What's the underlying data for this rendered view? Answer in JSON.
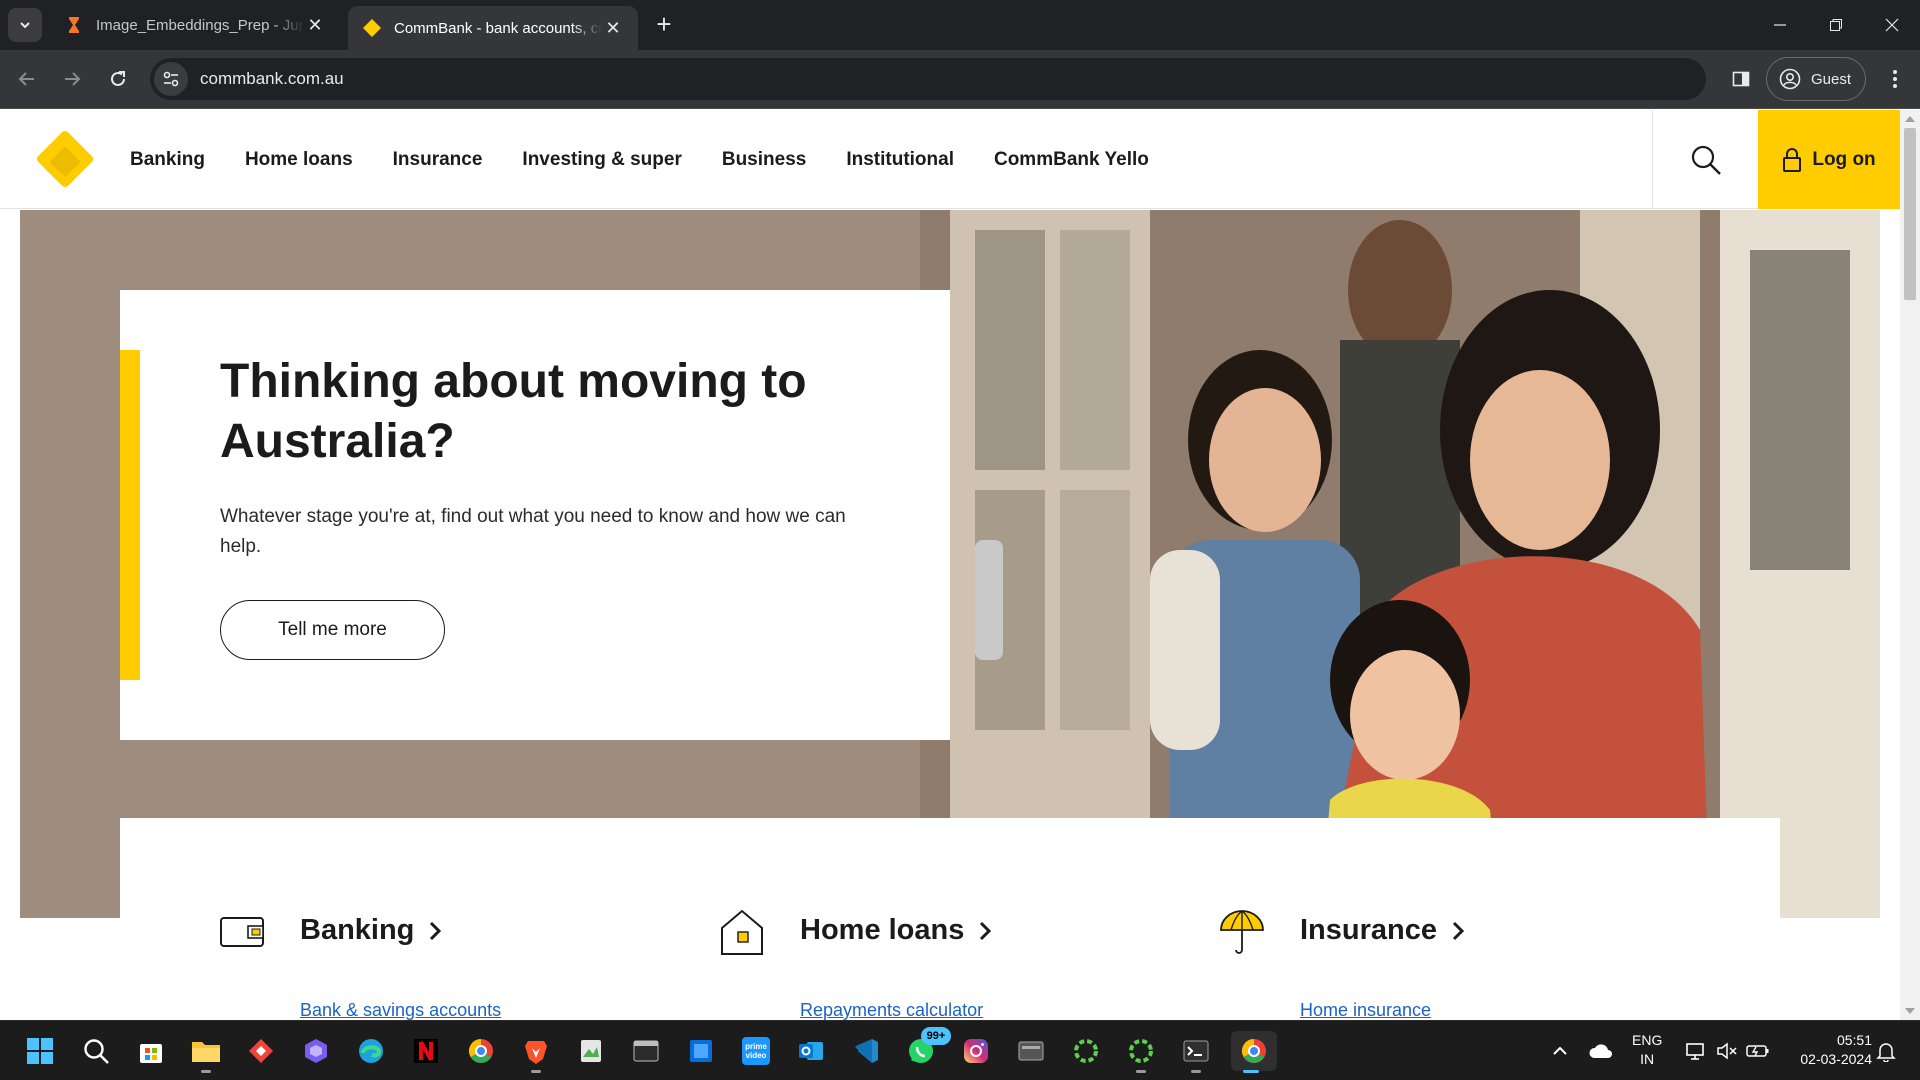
{
  "browser": {
    "tabs": [
      {
        "title": "Image_Embeddings_Prep - Jupyter",
        "active": false
      },
      {
        "title": "CommBank - bank accounts, credit cards",
        "active": true
      }
    ],
    "url": "commbank.com.au",
    "profile_label": "Guest"
  },
  "site": {
    "brand_color": "#ffcc00",
    "nav": [
      "Banking",
      "Home loans",
      "Insurance",
      "Investing & super",
      "Business",
      "Institutional",
      "CommBank Yello"
    ],
    "logon_label": "Log on"
  },
  "hero": {
    "title": "Thinking about moving to Australia?",
    "subtitle": "Whatever stage you're at, find out what you need to know and how we can help.",
    "cta_label": "Tell me more"
  },
  "products": [
    {
      "title": "Banking",
      "icon": "wallet-icon",
      "first_link": "Bank & savings accounts"
    },
    {
      "title": "Home loans",
      "icon": "house-icon",
      "first_link": "Repayments calculator"
    },
    {
      "title": "Insurance",
      "icon": "umbrella-icon",
      "first_link": "Home insurance"
    }
  ],
  "taskbar": {
    "whatsapp_badge": "99+",
    "language": {
      "line1": "ENG",
      "line2": "IN"
    },
    "clock": {
      "time": "05:51",
      "date": "02-03-2024"
    }
  }
}
